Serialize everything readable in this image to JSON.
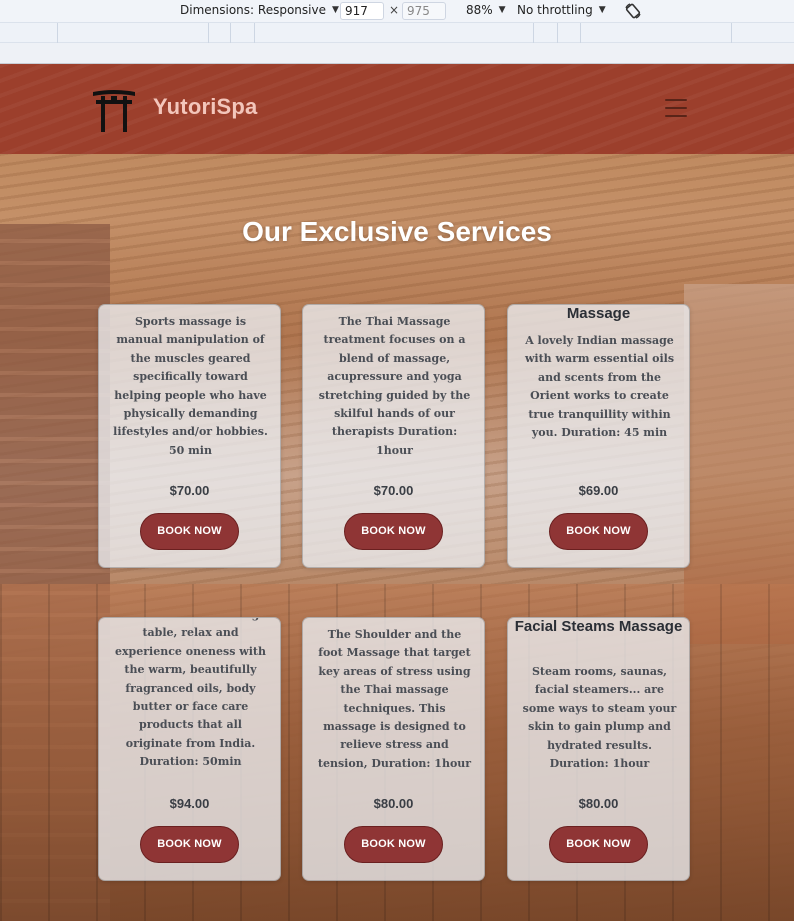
{
  "devtools": {
    "dimensions_label": "Dimensions: Responsive",
    "width_value": "917",
    "height_value": "975",
    "times_symbol": "×",
    "zoom_label": "88%",
    "throttle_label": "No throttling",
    "dropdown_arrow": "▼"
  },
  "navbar": {
    "brand": "YutoriSpa",
    "logo_icon": "torii-gate-icon",
    "menu_icon": "hamburger-menu-icon",
    "bg_color": "#9c3f2c",
    "brand_color": "#f3c6bb"
  },
  "section": {
    "title": "Our Exclusive Services"
  },
  "services": [
    {
      "title": "",
      "description": "Sports massage is manual manipulation of the muscles geared specifically toward helping people who have physically demanding lifestyles and/or hobbies. 50 min",
      "price": "$70.00",
      "button": "BOOK NOW"
    },
    {
      "title": "",
      "description": "The Thai Massage treatment focuses on a blend of massage, acupressure and yoga stretching guided by the skilful hands of our therapists Duration: 1hour",
      "price": "$70.00",
      "button": "BOOK NOW"
    },
    {
      "title": "Massage",
      "description": "A lovely Indian massage with warm essential oils and scents from the Orient works to create true tranquillity within you. Duration: 45 min",
      "price": "$69.00",
      "button": "BOOK NOW"
    },
    {
      "title": "",
      "description": "Lie back on the massage table, relax and experience oneness with the warm, beautifully fragranced oils, body butter or face care products that all originate from India. Duration: 50min",
      "price": "$94.00",
      "button": "BOOK NOW"
    },
    {
      "title": "",
      "description": "The Shoulder and the foot Massage that target key areas of stress using the Thai massage techniques. This massage is designed to relieve stress and tension, Duration: 1hour",
      "price": "$80.00",
      "button": "BOOK NOW"
    },
    {
      "title": "Facial Steams Massage",
      "description": "Steam rooms, saunas, facial steamers... are some ways to steam your skin to gain plump and hydrated results. Duration: 1hour",
      "price": "$80.00",
      "button": "BOOK NOW"
    }
  ],
  "colors": {
    "button": "#8f3535",
    "card": "#eceef2"
  }
}
